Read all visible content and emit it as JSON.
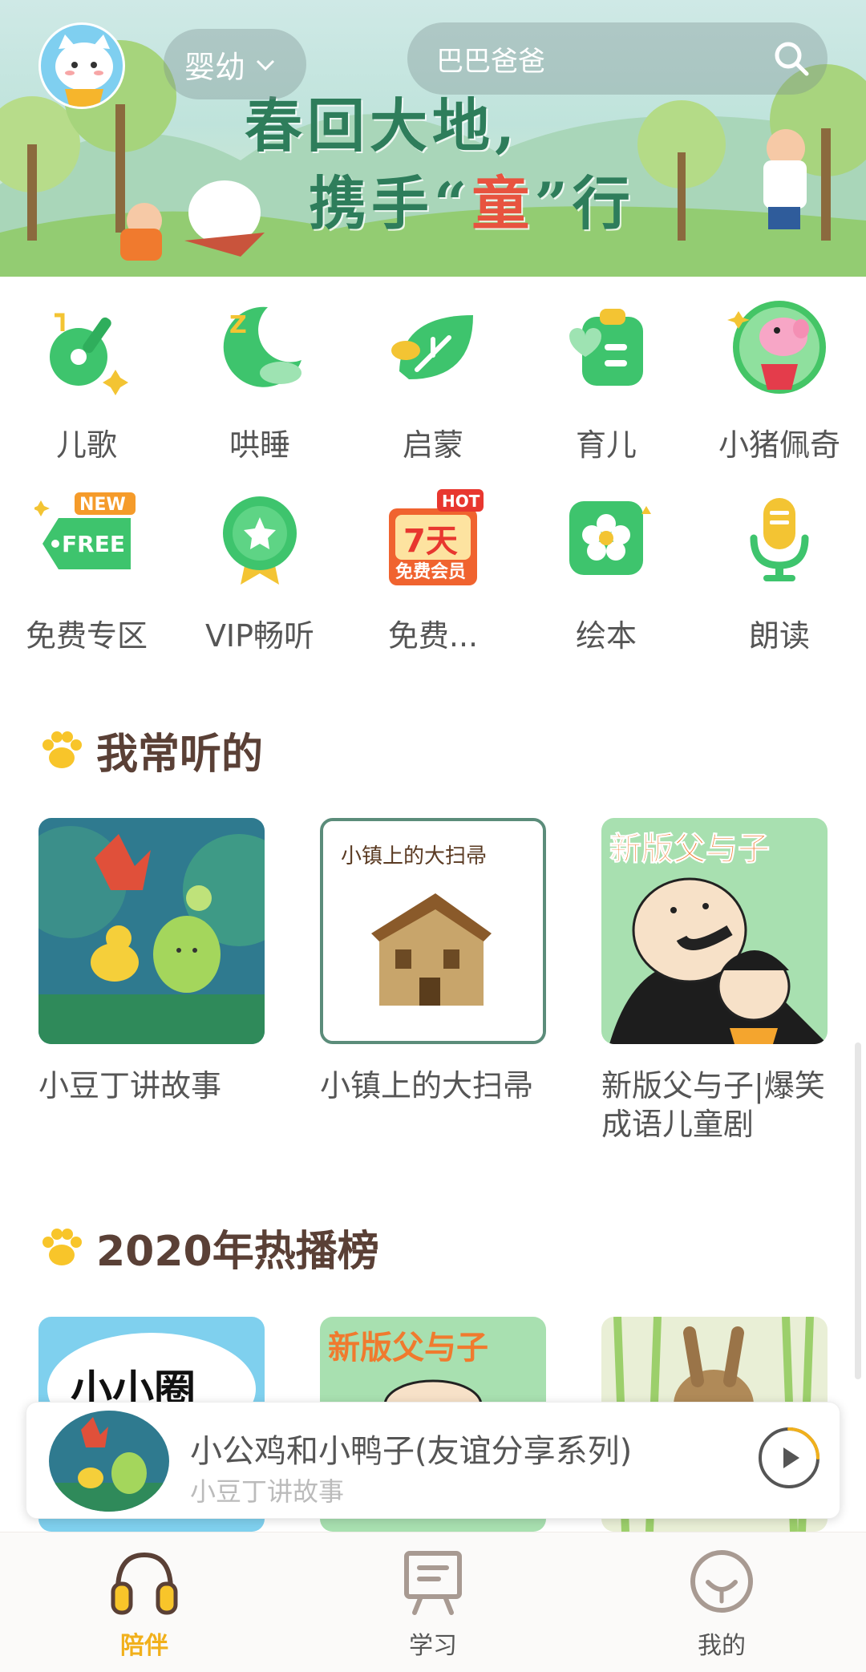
{
  "header": {
    "banner_line1": "春回大地,",
    "banner_line2_left": "携手“",
    "banner_line2_accent": "童",
    "banner_line2_right": "”行",
    "age_label": "婴幼",
    "search_placeholder": "巴巴爸爸"
  },
  "categories": [
    {
      "label": "儿歌",
      "icon": "guitar-icon"
    },
    {
      "label": "哄睡",
      "icon": "moon-icon"
    },
    {
      "label": "启蒙",
      "icon": "leaf-icon"
    },
    {
      "label": "育儿",
      "icon": "clipboard-icon"
    },
    {
      "label": "小猪佩奇",
      "icon": "peppa-pig-icon"
    },
    {
      "label": "免费专区",
      "icon": "free-tag-icon",
      "badge": "NEW",
      "tag": "FREE"
    },
    {
      "label": "VIP畅听",
      "icon": "vip-medal-icon"
    },
    {
      "label": "免费...",
      "icon": "free-membership-icon",
      "badge": "HOT",
      "tag_big": "7天",
      "tag_small": "免费会员"
    },
    {
      "label": "绘本",
      "icon": "flower-book-icon"
    },
    {
      "label": "朗读",
      "icon": "microphone-icon"
    }
  ],
  "sections": {
    "frequent": {
      "title": "我常听的",
      "items": [
        {
          "title": "小豆丁讲故事"
        },
        {
          "title": "小镇上的大扫帚",
          "cover_text": "小镇上的大扫帚"
        },
        {
          "title": "新版父与子|爆笑成语儿童剧",
          "cover_text": "新版父与子"
        }
      ]
    },
    "hot2020": {
      "title": "2020年热播榜",
      "items": [
        {
          "cover_text": "小小圈"
        },
        {
          "cover_text": "新版父与子"
        },
        {
          "cover_text": ""
        }
      ]
    }
  },
  "player": {
    "title": "小公鸡和小鸭子(友谊分享系列)",
    "subtitle": "小豆丁讲故事",
    "progress": 0.25
  },
  "nav": {
    "items": [
      {
        "label": "陪伴",
        "icon": "headphones-icon",
        "active": true
      },
      {
        "label": "学习",
        "icon": "board-icon",
        "active": false
      },
      {
        "label": "我的",
        "icon": "smile-face-icon",
        "active": false
      }
    ]
  },
  "colors": {
    "accent": "#f1b01b",
    "green": "#3ec46d",
    "title": "#5a4036"
  }
}
